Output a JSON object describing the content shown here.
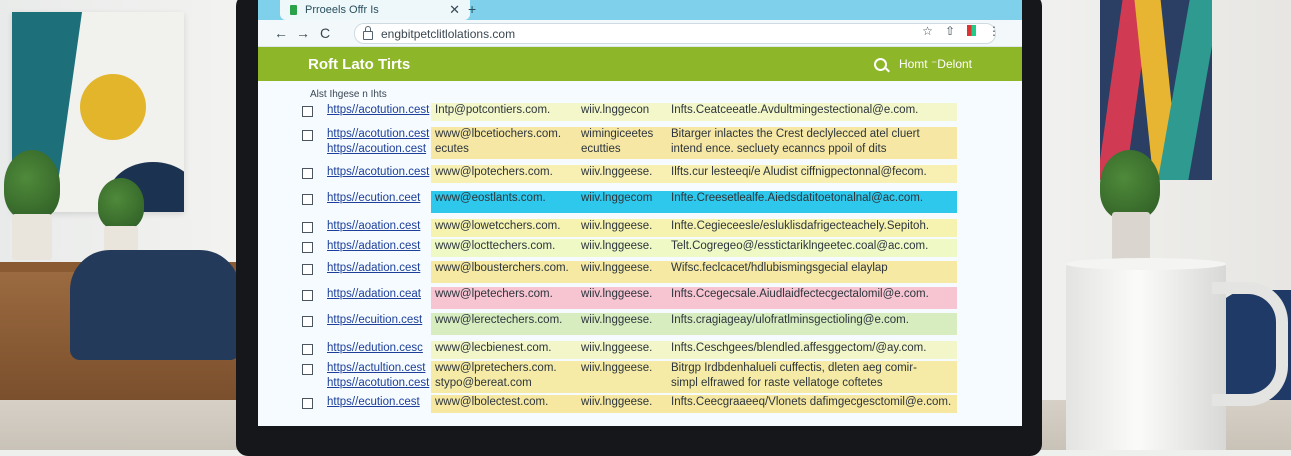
{
  "browser": {
    "tab_title": "Prroeels Offr Is",
    "tab_close": "✕",
    "new_tab": "+",
    "url": "engbitpetclitlolations.com",
    "back": "←",
    "forward": "→",
    "reload": "C"
  },
  "app": {
    "title": "Roft Lato Tirts",
    "header_right": "Homt ⁻Delont",
    "section_label": "Alst Ihgese n Ihts"
  },
  "rows": [
    {
      "col1": "https//acotution.cest",
      "col2": "Intp@potcontiers.com.",
      "col3": "wiiv.lnggecon",
      "col4": "Infts.Ceatceeatle.Avdultmingestectional@e.com.",
      "color": "#f3f7c9"
    },
    {
      "col1": "https//acotution.cest\nhttps//acoution.cest",
      "col2": "www@lbcetiochers.com.\necutes",
      "col3": "wimingiceetes\necutties",
      "col4": "Bitarger inlactes the Crest declylecced atel cluert\nintend ence. secluety ecanncs ppoil of dits",
      "color": "#f6e7a4"
    },
    {
      "col1": "https//acotution.cest",
      "col2": "www@lpotechers.com.",
      "col3": "wiiv.lnggeese.",
      "col4": "Ilfts.cur lesteeqi/e Aludist ciffnigpectonnal@fecom.",
      "color": "#f8efb2"
    },
    {
      "col1": "https//ecution.ceet",
      "col2": "www@eostlants.com.",
      "col3": "wiiv.lnggecom",
      "col4": "Infte.Creesetlealfe.Aiedsdatitoetonalnal@ac.com.",
      "color": "#2ec8ec"
    },
    {
      "col1": "https//aoation.cest",
      "col2": "www@lowetcchers.com.",
      "col3": "wiiv.lnggeese.",
      "col4": "Infte.Cegieceesle/esluklisdafrigecteachely.Sepitoh.",
      "color": "#f6f2b0"
    },
    {
      "col1": "https//adation.cest",
      "col2": "www@locttechers.com.",
      "col3": "wiiv.lnggeese.",
      "col4": "Telt.Cogregeo@/esstictariklngeetec.coal@ac.com.",
      "color": "#eef9c6"
    },
    {
      "col1": "https//adation.cest",
      "col2": "www@lbousterchers.com.",
      "col3": "wiiv.lnggeese.",
      "col4": "Wifsc.feclcacet/hdlubismingsgecial elaylap",
      "color": "#f6e9a4"
    },
    {
      "col1": "https//adation.ceat",
      "col2": "www@lpetechers.com.",
      "col3": "wiiv.lnggeese.",
      "col4": "Infts.Ccegecsale.Aiudlaidfectecgectalomil@e.com.",
      "color": "#f7c4d2"
    },
    {
      "col1": "https//ecuition.cest",
      "col2": "www@lerectechers.com.",
      "col3": "wiiv.lnggeese.",
      "col4": "Infts.cragiageay/ulofratlminsgectioling@e.com.",
      "color": "#d7edc0"
    },
    {
      "col1": "https//edution.cesc",
      "col2": "www@lecbienest.com.",
      "col3": "wiiv.lnggeese.",
      "col4": "Infts.Ceschgees/blendled.affesggectom/@ay.com.",
      "color": "#f2f6c8"
    },
    {
      "col1": "https//actultion.cest\nhttps//acotution.cest",
      "col2": "www@lpretechers.com.\nstypo@bereat.com",
      "col3": "wiiv.lnggeese.",
      "col4": "Bitrgp Irdbdenhalueli cuffectis, dleten aeg comir-\nsimpl elfrawed for raste vellatoge coftetes",
      "color": "#f6eba6"
    },
    {
      "col1": "https//ecution.cest",
      "col2": "www@lbolectest.com.",
      "col3": "wiiv.lnggeese.",
      "col4": "Infts.Ceecgraaeeq/Vlonets dafimgecgesctomil@e.com.",
      "color": "#f6e7a1"
    }
  ]
}
